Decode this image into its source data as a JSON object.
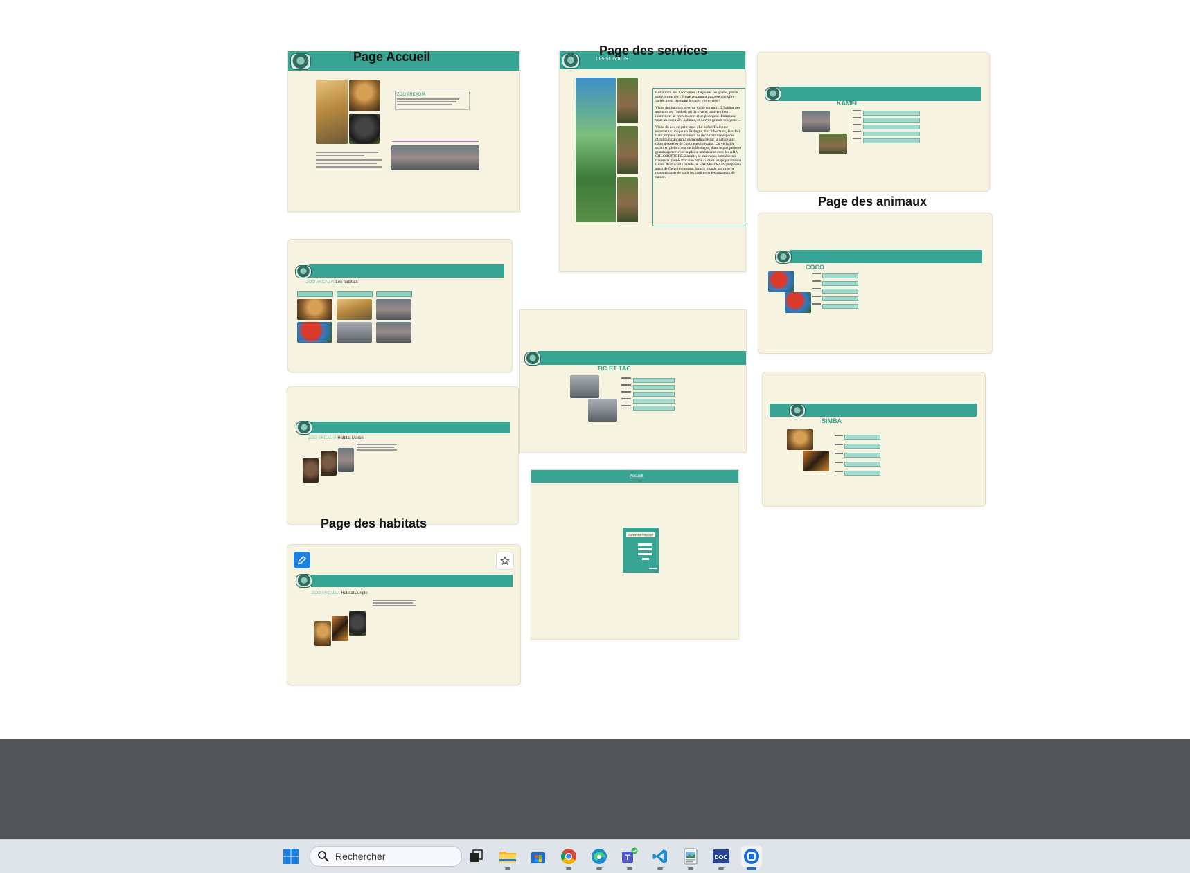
{
  "canvas": {
    "titles": {
      "accueil": "Page Accueil",
      "services": "Page des services",
      "animaux": "Page des animaux",
      "habitats": "Page des habitats"
    },
    "cards": {
      "services_header": "LES SERVICES",
      "services_text": {
        "restaurant": "Restaurant des Crocodiles : Déjeuner ou goûter, pause salée ou sucrée... Notre restaurant propose une offre variée, pour répondre à toutes vos envies !",
        "visite_guide": "Visite des habitats avec un guide (gratuit): L'habitat des animaux est l'endroit où ils vivent, trouvent leur nourriture, se reproduisent et se protègent. Immersez-vous au coeur des habitats, et ouvrez grands vos yeux ...",
        "petit_train": "Visite du zoo en petit train : Le Safari Train une experience unique en Bretagne. Sur 3 hectares, le safari train propose aux visiteurs de découvrir des espaces offrant un panorama extraordinaire sur la nature aux côtés d'espèces de continents lointains. Un véritable safari en plein coeur de la Bretagne, dans lequel petits et grands apercevront la plaine américaine avec les ARA CHLOROPTERE. Ensuite, le train vous emmènera à travers la plaine africaine entre Girafes Hippopotames et Lions. Au fil de la balade, le SAFARI TRAIN proposera aussi de Cette immersion dans le monde sauvage ne manquera pas de ravir les curieux et les amateurs de nature."
      },
      "kamel": "KAMEL",
      "coco": "COCO",
      "tic_et_tac": "TIC ET TAC",
      "simba": "SIMBA",
      "habitats_prefix": "ZOO ARCADIA",
      "habitats_title": " Les habitats",
      "marais_title": " Habitat Marais",
      "jungle_title": " Habitat Jungle",
      "login_link": "Accueil",
      "login_title": "Connexion Employé"
    },
    "colors": {
      "teal": "#38a493",
      "cream": "#f6f3e0"
    }
  },
  "taskbar": {
    "search_placeholder": "Rechercher",
    "apps": [
      "windows-start",
      "task-view",
      "file-explorer",
      "microsoft-store",
      "chrome",
      "edge",
      "teams",
      "vscode",
      "photo-viewer",
      "doc-app",
      "screen-capture"
    ]
  }
}
